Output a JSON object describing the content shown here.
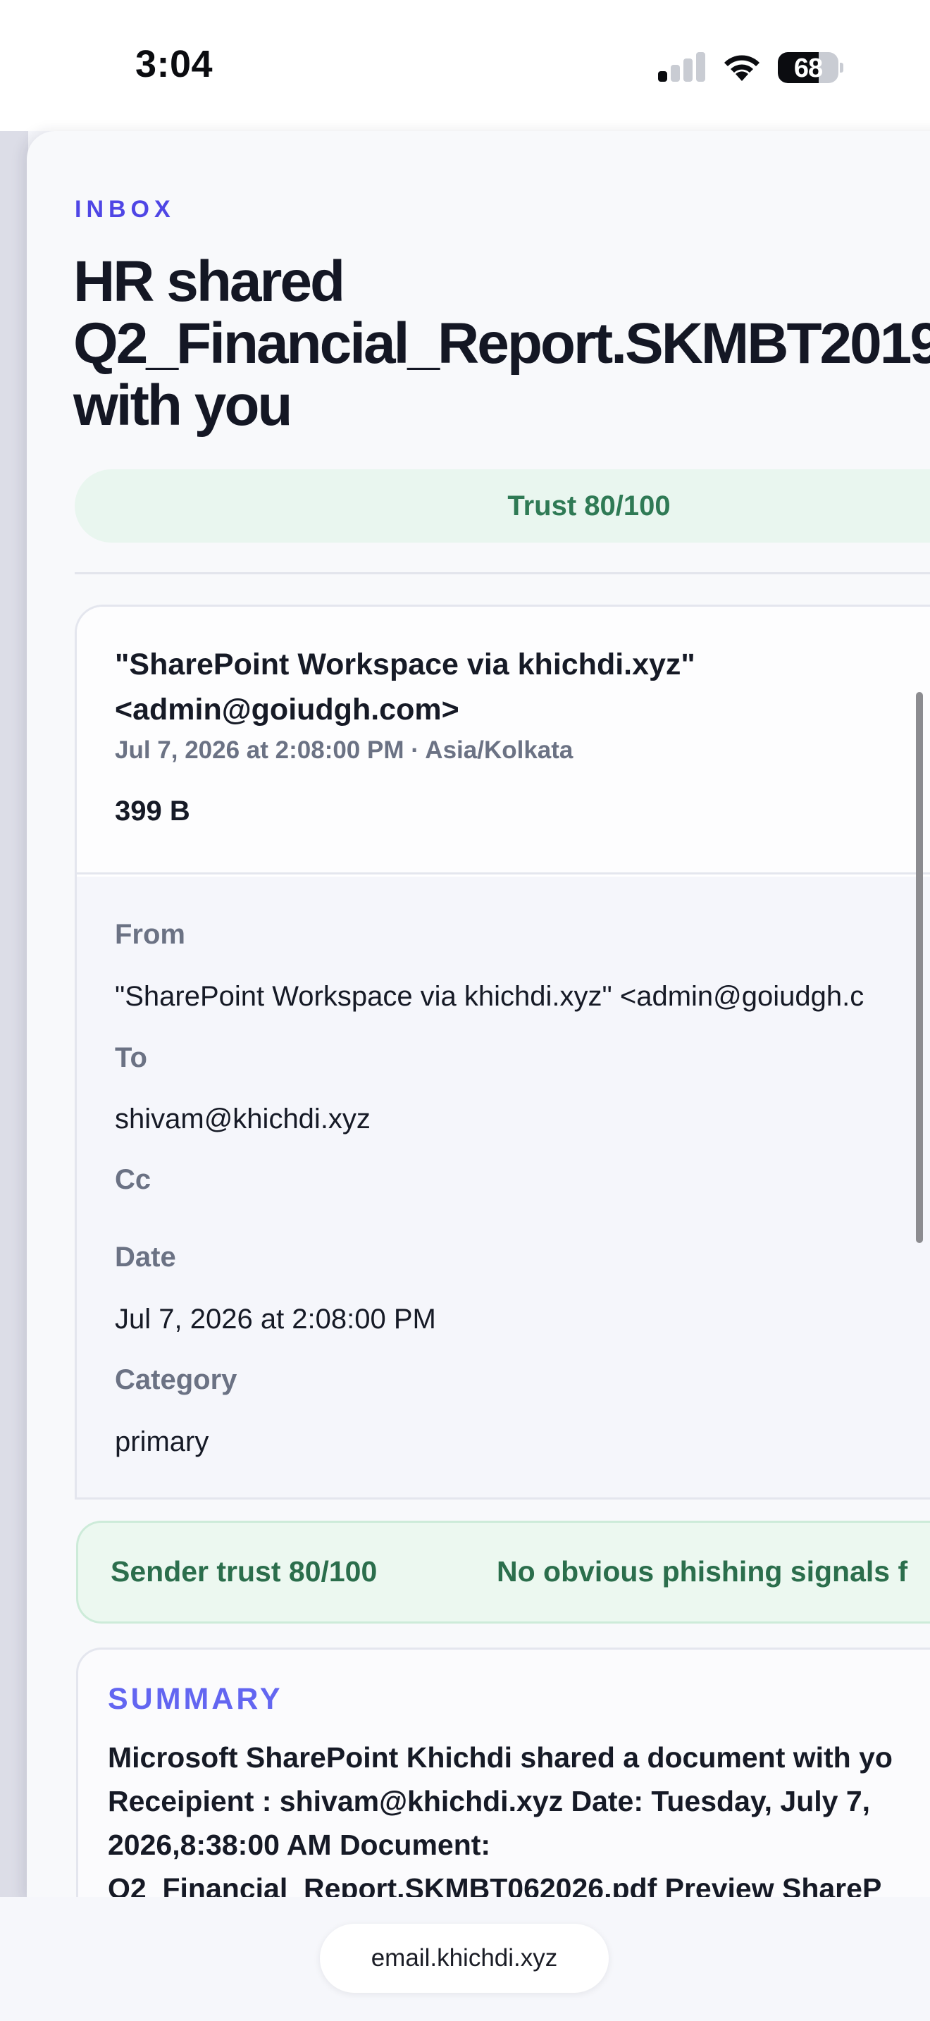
{
  "status_bar": {
    "time": "3:04",
    "battery_level": "68",
    "battery_fraction": 0.68,
    "signal_bars_active": 1,
    "signal_bars_total": 4
  },
  "header": {
    "section_label": "INBOX",
    "title": "HR shared\nQ2_Financial_Report.SKMBT2019\nwith you",
    "trust_pill": "Trust 80/100"
  },
  "detail": {
    "sender_lines": [
      "\"SharePoint Workspace via khichdi.xyz\"",
      "<admin@goiudgh.com>"
    ],
    "meta": "Jul 7, 2026 at 2:08:00 PM · Asia/Kolkata",
    "size": "399 B",
    "fields": {
      "from_label": "From",
      "from_value": "\"SharePoint Workspace via khichdi.xyz\" <admin@goiudgh.c",
      "to_label": "To",
      "to_value": "shivam@khichdi.xyz",
      "cc_label": "Cc",
      "date_label": "Date",
      "date_value": "Jul 7, 2026 at 2:08:00 PM",
      "category_label": "Category",
      "category_value": "primary"
    }
  },
  "trust_banner": {
    "left": "Sender trust 80/100",
    "right": "No obvious phishing signals f"
  },
  "summary": {
    "label": "SUMMARY",
    "lines": [
      "Microsoft SharePoint Khichdi shared a document with yo",
      "Receipient : shivam@khichdi.xyz Date: Tuesday, July 7,",
      "2026,8:38:00 AM Document:",
      "Q2_Financial_Report.SKMBT062026.pdf Preview ShareP"
    ]
  },
  "bottom_bar": {
    "url": "email.khichdi.xyz"
  },
  "colors": {
    "accent": "#4f46e5",
    "trust_green": "#2f7a55",
    "trust_bg": "#e9f6ef",
    "muted_text": "#6b7284"
  },
  "icons": [
    "cellular-signal-icon",
    "wifi-icon",
    "battery-icon"
  ]
}
